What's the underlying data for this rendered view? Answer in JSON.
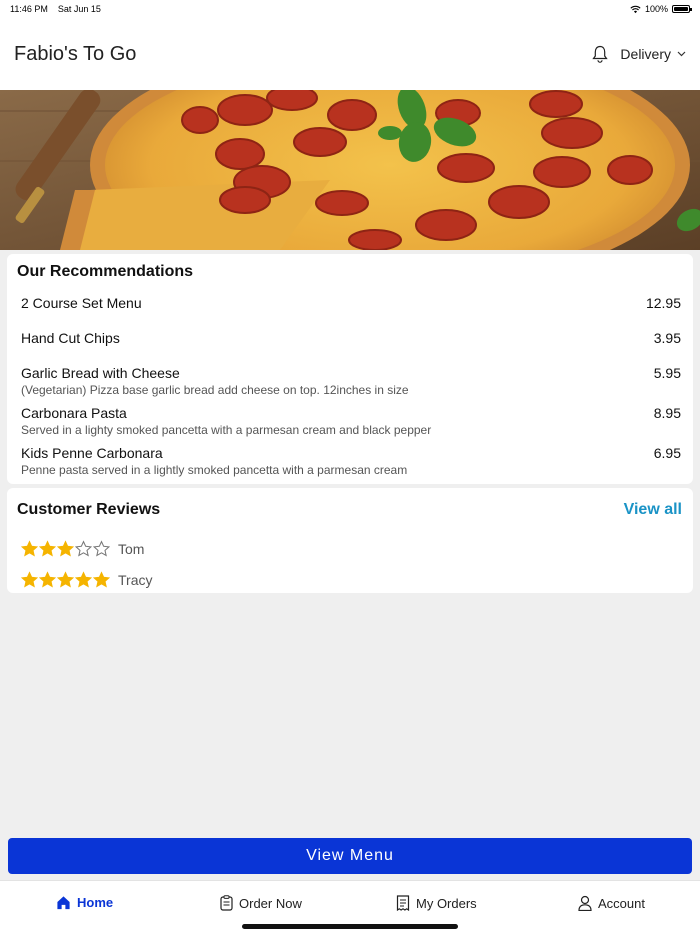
{
  "status_bar": {
    "time": "11:46 PM",
    "date": "Sat Jun 15",
    "battery": "100%"
  },
  "header": {
    "title": "Fabio's To Go",
    "delivery_label": "Delivery"
  },
  "recommendations": {
    "title": "Our Recommendations",
    "items": [
      {
        "name": "2 Course Set Menu",
        "desc": "",
        "price": "12.95"
      },
      {
        "name": "Hand Cut Chips",
        "desc": "",
        "price": "3.95"
      },
      {
        "name": "Garlic Bread with Cheese",
        "desc": "(Vegetarian) Pizza base garlic bread add cheese on top. 12inches in size",
        "price": "5.95"
      },
      {
        "name": "Carbonara Pasta",
        "desc": "Served in a lighty smoked pancetta with a parmesan cream and black pepper",
        "price": "8.95"
      },
      {
        "name": "Kids Penne Carbonara",
        "desc": "Penne pasta served in a lightly smoked pancetta with a parmesan cream",
        "price": "6.95"
      }
    ]
  },
  "reviews": {
    "title": "Customer Reviews",
    "view_all_label": "View all",
    "items": [
      {
        "name": "Tom",
        "rating": 3,
        "max": 5
      },
      {
        "name": "Tracy",
        "rating": 5,
        "max": 5
      }
    ]
  },
  "view_menu_label": "View Menu",
  "tabs": [
    {
      "label": "Home",
      "icon": "home-icon",
      "active": true
    },
    {
      "label": "Order Now",
      "icon": "clipboard-icon",
      "active": false
    },
    {
      "label": "My Orders",
      "icon": "receipt-icon",
      "active": false
    },
    {
      "label": "Account",
      "icon": "person-icon",
      "active": false
    }
  ],
  "colors": {
    "accent": "#0a35d6",
    "link": "#1a93c6",
    "star": "#f5b400"
  }
}
